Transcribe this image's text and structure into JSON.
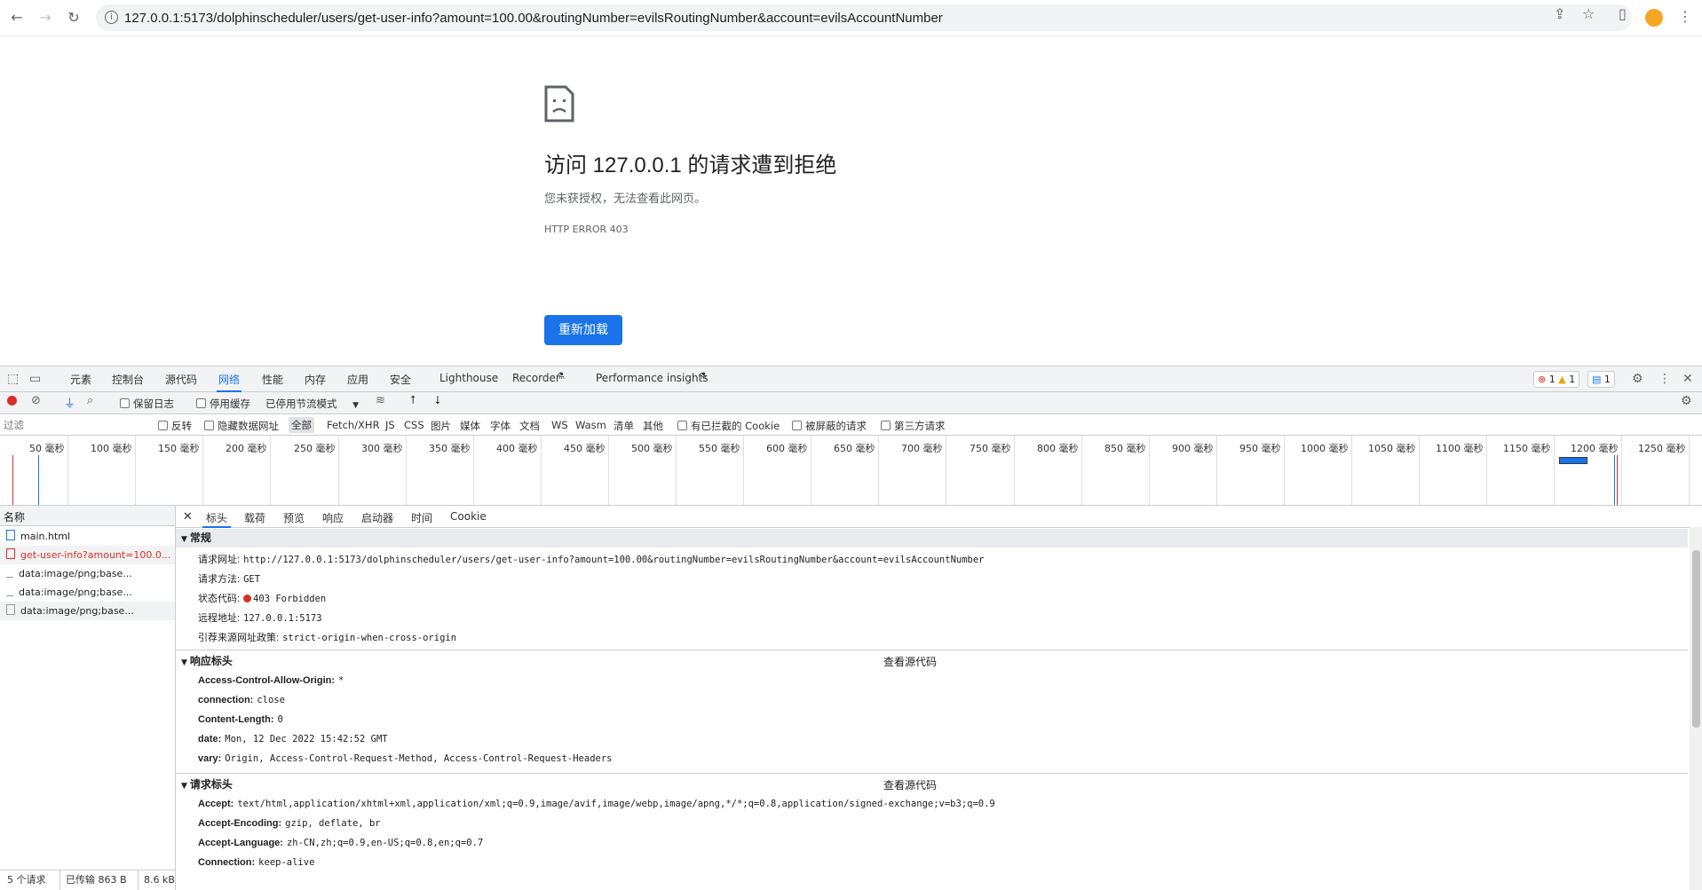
{
  "browser": {
    "url": "127.0.0.1:5173/dolphinscheduler/users/get-user-info?amount=100.00&routingNumber=evilsRoutingNumber&account=evilsAccountNumber"
  },
  "error_page": {
    "title": "访问 127.0.0.1 的请求遭到拒绝",
    "description": "您未获授权，无法查看此网页。",
    "code": "HTTP ERROR 403",
    "reload_label": "重新加载"
  },
  "devtools": {
    "tabs": [
      "元素",
      "控制台",
      "源代码",
      "网络",
      "性能",
      "内存",
      "应用",
      "安全",
      "Lighthouse",
      "Recorder",
      "Performance insights"
    ],
    "active_tab": "网络",
    "badges": {
      "errors": "1",
      "warnings": "1",
      "messages": "1"
    },
    "toolbar": {
      "preserve_log": "保留日志",
      "disable_cache": "停用缓存",
      "throttling": "已停用节流模式"
    },
    "filter": {
      "placeholder": "过滤",
      "invert": "反转",
      "hide_data_urls": "隐藏数据网址",
      "types": [
        "全部",
        "Fetch/XHR",
        "JS",
        "CSS",
        "图片",
        "媒体",
        "字体",
        "文档",
        "WS",
        "Wasm",
        "清单",
        "其他"
      ],
      "blocked_cookies": "有已拦截的 Cookie",
      "blocked_requests": "被屏蔽的请求",
      "third_party": "第三方请求"
    },
    "timeline_ticks": [
      "50 毫秒",
      "100 毫秒",
      "150 毫秒",
      "200 毫秒",
      "250 毫秒",
      "300 毫秒",
      "350 毫秒",
      "400 毫秒",
      "450 毫秒",
      "500 毫秒",
      "550 毫秒",
      "600 毫秒",
      "650 毫秒",
      "700 毫秒",
      "750 毫秒",
      "800 毫秒",
      "850 毫秒",
      "900 毫秒",
      "950 毫秒",
      "1000 毫秒",
      "1050 毫秒",
      "1100 毫秒",
      "1150 毫秒",
      "1200 毫秒",
      "1250 毫秒"
    ],
    "requests_header": "名称",
    "requests": [
      {
        "name": "main.html",
        "error": false
      },
      {
        "name": "get-user-info?amount=100.0...",
        "error": true
      },
      {
        "name": "data:image/png;base...",
        "error": false
      },
      {
        "name": "data:image/png;base...",
        "error": false
      },
      {
        "name": "data:image/png;base...",
        "error": false
      }
    ],
    "status": {
      "count": "5 个请求",
      "transferred": "已传输 863 B",
      "size": "8.6 kB"
    },
    "detail_tabs": [
      "标头",
      "载荷",
      "预览",
      "响应",
      "启动器",
      "时间",
      "Cookie"
    ],
    "general": {
      "title": "常规",
      "items": [
        {
          "k": "请求网址:",
          "v": "http://127.0.0.1:5173/dolphinscheduler/users/get-user-info?amount=100.00&routingNumber=evilsRoutingNumber&account=evilsAccountNumber"
        },
        {
          "k": "请求方法:",
          "v": "GET"
        },
        {
          "k": "状态代码:",
          "v": "403 Forbidden"
        },
        {
          "k": "远程地址:",
          "v": "127.0.0.1:5173"
        },
        {
          "k": "引荐来源网址政策:",
          "v": "strict-origin-when-cross-origin"
        }
      ]
    },
    "response_headers": {
      "title": "响应标头",
      "view_source": "查看源代码",
      "items": [
        {
          "k": "Access-Control-Allow-Origin:",
          "v": "*"
        },
        {
          "k": "connection:",
          "v": "close"
        },
        {
          "k": "Content-Length:",
          "v": "0"
        },
        {
          "k": "date:",
          "v": "Mon, 12 Dec 2022 15:42:52 GMT"
        },
        {
          "k": "vary:",
          "v": "Origin, Access-Control-Request-Method, Access-Control-Request-Headers"
        }
      ]
    },
    "request_headers": {
      "title": "请求标头",
      "view_source": "查看源代码",
      "items": [
        {
          "k": "Accept:",
          "v": "text/html,application/xhtml+xml,application/xml;q=0.9,image/avif,image/webp,image/apng,*/*;q=0.8,application/signed-exchange;v=b3;q=0.9"
        },
        {
          "k": "Accept-Encoding:",
          "v": "gzip, deflate, br"
        },
        {
          "k": "Accept-Language:",
          "v": "zh-CN,zh;q=0.9,en-US;q=0.8,en;q=0.7"
        },
        {
          "k": "Connection:",
          "v": "keep-alive"
        }
      ]
    }
  },
  "colors": {
    "accent": "#1a73e8",
    "error": "#d93025"
  }
}
